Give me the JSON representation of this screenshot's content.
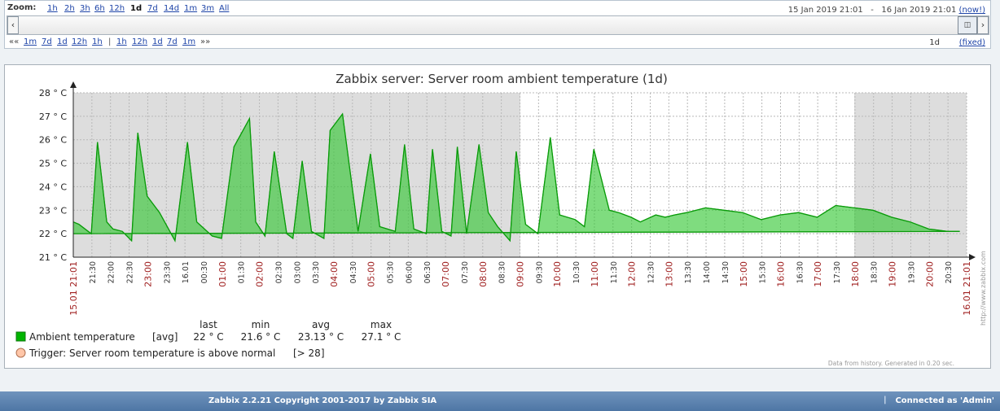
{
  "zoom": {
    "label": "Zoom:",
    "periods": [
      "1h",
      "2h",
      "3h",
      "6h",
      "12h",
      "1d",
      "7d",
      "14d",
      "1m",
      "3m",
      "All"
    ],
    "selected": "1d"
  },
  "time_range": {
    "start": "15 Jan 2019 21:01",
    "separator": "-",
    "end": "16 Jan 2019 21:01",
    "now_label": "(now!)"
  },
  "scrollbar": {
    "left_arrow": "‹",
    "right_arrow": "›",
    "handle_icon": "◫"
  },
  "navigation": {
    "back_prefix": "««",
    "back_steps": [
      "1m",
      "7d",
      "1d",
      "12h",
      "1h"
    ],
    "separator": "|",
    "forward_steps": [
      "1h",
      "12h",
      "1d",
      "7d",
      "1m"
    ],
    "forward_suffix": "»»",
    "period": "1d",
    "fixed": "(fixed)"
  },
  "chart_data": {
    "type": "area",
    "title": "Zabbix server: Server room ambient temperature (1d)",
    "ylim": [
      21,
      28
    ],
    "y_ticks": [
      "28 ° C",
      "27 ° C",
      "26 ° C",
      "25 ° C",
      "24 ° C",
      "23 ° C",
      "22 ° C",
      "21 ° C"
    ],
    "x_ticks": [
      "15.01 21:01",
      "21:30",
      "22:00",
      "22:30",
      "23:00",
      "23:30",
      "16.01",
      "00:30",
      "01:00",
      "01:30",
      "02:00",
      "02:30",
      "03:00",
      "03:30",
      "04:00",
      "04:30",
      "05:00",
      "05:30",
      "06:00",
      "06:30",
      "07:00",
      "07:30",
      "08:00",
      "08:30",
      "09:00",
      "09:30",
      "10:00",
      "10:30",
      "11:00",
      "11:30",
      "12:00",
      "12:30",
      "13:00",
      "13:30",
      "14:00",
      "14:30",
      "15:00",
      "15:30",
      "16:00",
      "16:30",
      "17:00",
      "17:30",
      "18:00",
      "18:30",
      "19:00",
      "19:30",
      "20:00",
      "20:30",
      "16.01 21:01"
    ],
    "highlighted_ticks": [
      "15.01 21:01",
      "23:00",
      "01:00",
      "02:00",
      "04:00",
      "05:00",
      "07:00",
      "08:00",
      "09:00",
      "10:00",
      "11:00",
      "12:00",
      "13:00",
      "15:00",
      "16:00",
      "17:00",
      "18:00",
      "19:00",
      "20:00",
      "16.01 21:01"
    ],
    "series": [
      {
        "name": "Ambient temperature",
        "x": [
          "21:01",
          "21:10",
          "21:25",
          "21:30",
          "21:40",
          "21:55",
          "22:05",
          "22:20",
          "22:35",
          "22:45",
          "23:00",
          "23:20",
          "23:45",
          "00:05",
          "00:20",
          "00:45",
          "01:00",
          "01:20",
          "01:45",
          "01:55",
          "02:10",
          "02:25",
          "02:45",
          "02:55",
          "03:10",
          "03:25",
          "03:45",
          "03:55",
          "04:15",
          "04:40",
          "05:00",
          "05:15",
          "05:40",
          "05:55",
          "06:10",
          "06:30",
          "06:40",
          "06:55",
          "07:10",
          "07:20",
          "07:35",
          "07:55",
          "08:10",
          "08:25",
          "08:45",
          "08:55",
          "09:10",
          "09:30",
          "09:50",
          "10:05",
          "10:30",
          "10:45",
          "11:00",
          "11:25",
          "11:40",
          "12:00",
          "12:15",
          "12:40",
          "12:55",
          "13:10",
          "13:30",
          "14:00",
          "14:30",
          "15:00",
          "15:30",
          "16:00",
          "16:30",
          "17:00",
          "17:30",
          "18:00",
          "18:30",
          "19:00",
          "19:30",
          "20:00",
          "20:30",
          "20:50",
          "21:01"
        ],
        "values": [
          22.5,
          22.4,
          22.1,
          22.0,
          25.9,
          22.5,
          22.2,
          22.1,
          21.7,
          26.3,
          23.6,
          22.9,
          21.7,
          25.9,
          22.5,
          21.9,
          21.8,
          25.7,
          26.9,
          22.5,
          21.9,
          25.5,
          22.0,
          21.8,
          25.1,
          22.1,
          21.8,
          26.4,
          27.1,
          22.1,
          25.4,
          22.3,
          22.1,
          25.8,
          22.2,
          22.0,
          25.6,
          22.1,
          21.9,
          25.7,
          22.0,
          25.8,
          22.9,
          22.3,
          21.7,
          25.5,
          22.4,
          22.0,
          26.1,
          22.8,
          22.6,
          22.3,
          25.6,
          23.0,
          22.9,
          22.7,
          22.5,
          22.8,
          22.7,
          22.8,
          22.9,
          23.1,
          23.0,
          22.9,
          22.6,
          22.8,
          22.9,
          22.7,
          23.2,
          23.1,
          23.0,
          22.7,
          22.5,
          22.2,
          22.1,
          22.1,
          22.0
        ]
      }
    ],
    "legend": {
      "headers": [
        "last",
        "min",
        "avg",
        "max"
      ],
      "items": [
        {
          "label": "Ambient temperature",
          "func": "[avg]",
          "last": "22 ° C",
          "min": "21.6 ° C",
          "avg": "23.13 ° C",
          "max": "27.1 ° C",
          "color": "#00b400"
        },
        {
          "label": "Trigger: Server room temperature is above normal",
          "value": "[> 28]",
          "color": "#ffc6a8"
        }
      ]
    },
    "watermark": "http://www.zabbix.com",
    "note": "Data from history. Generated in 0.20 sec."
  },
  "footer": {
    "copyright": "Zabbix 2.2.21 Copyright 2001-2017 by Zabbix SIA",
    "separator": "|",
    "connected": "Connected as 'Admin'"
  },
  "colors": {
    "series_line": "#00b400",
    "series_fill": "#30c630",
    "shaded_bg": "#dddddd",
    "white_bg": "#ffffff",
    "highlight_tick": "#a02020",
    "footer": "#5b80ad"
  }
}
